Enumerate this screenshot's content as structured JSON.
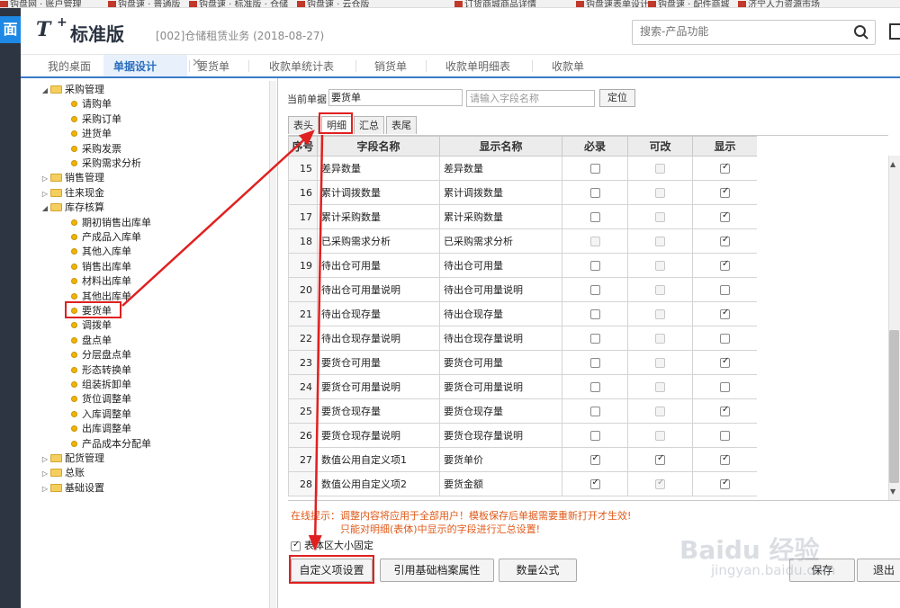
{
  "bookmarks": [
    "钩盘网 · 账户管理",
    "钩盘速 · 普通版",
    "钩盘速 · 标准版 · 仓储",
    "钩盘速 · 云仓版",
    "订货商城商品详情",
    "钩盘速表单设计",
    "钩盘速 · 配件商城",
    "济宁人力资源市场"
  ],
  "rail": {
    "logo": "面"
  },
  "header": {
    "app_name": "标准版",
    "company": "[002]仓储租赁业务   (2018-08-27)",
    "search_placeholder": "搜索-产品功能"
  },
  "tabs": [
    {
      "label": "我的桌面"
    },
    {
      "label": "单据设计"
    },
    {
      "label": "要货单"
    },
    {
      "label": "收款单统计表"
    },
    {
      "label": "销货单"
    },
    {
      "label": "收款单明细表"
    },
    {
      "label": "收款单"
    }
  ],
  "tab_close": "✕",
  "tree": [
    {
      "label": "采购管理",
      "kind": "folder",
      "open": true
    },
    {
      "label": "请购单",
      "kind": "leaf"
    },
    {
      "label": "采购订单",
      "kind": "leaf"
    },
    {
      "label": "进货单",
      "kind": "leaf"
    },
    {
      "label": "采购发票",
      "kind": "leaf"
    },
    {
      "label": "采购需求分析",
      "kind": "leaf"
    },
    {
      "label": "销售管理",
      "kind": "folder",
      "open": false
    },
    {
      "label": "往来现金",
      "kind": "folder",
      "open": false
    },
    {
      "label": "库存核算",
      "kind": "folder",
      "open": true
    },
    {
      "label": "期初销售出库单",
      "kind": "leaf"
    },
    {
      "label": "产成品入库单",
      "kind": "leaf"
    },
    {
      "label": "其他入库单",
      "kind": "leaf"
    },
    {
      "label": "销售出库单",
      "kind": "leaf"
    },
    {
      "label": "材料出库单",
      "kind": "leaf"
    },
    {
      "label": "其他出库单",
      "kind": "leaf"
    },
    {
      "label": "要货单",
      "kind": "leaf"
    },
    {
      "label": "调拨单",
      "kind": "leaf"
    },
    {
      "label": "盘点单",
      "kind": "leaf"
    },
    {
      "label": "分层盘点单",
      "kind": "leaf"
    },
    {
      "label": "形态转换单",
      "kind": "leaf"
    },
    {
      "label": "组装拆卸单",
      "kind": "leaf"
    },
    {
      "label": "货位调整单",
      "kind": "leaf"
    },
    {
      "label": "入库调整单",
      "kind": "leaf"
    },
    {
      "label": "出库调整单",
      "kind": "leaf"
    },
    {
      "label": "产品成本分配单",
      "kind": "leaf"
    },
    {
      "label": "配货管理",
      "kind": "folder",
      "open": false
    },
    {
      "label": "总账",
      "kind": "folder",
      "open": false
    },
    {
      "label": "基础设置",
      "kind": "folder",
      "open": false
    }
  ],
  "form": {
    "current_label": "当前单据",
    "current_value": "要货单",
    "field_placeholder": "请输入字段名称",
    "locate_label": "定位"
  },
  "subtabs": [
    "表头",
    "明细",
    "汇总",
    "表尾"
  ],
  "grid": {
    "columns": [
      "序号",
      "字段名称",
      "显示名称",
      "必录",
      "可改",
      "显示"
    ],
    "rows": [
      {
        "no": "15",
        "field": "差异数量",
        "display": "差异数量",
        "required": false,
        "required_dis": false,
        "editable": false,
        "editable_dis": true,
        "show": true
      },
      {
        "no": "16",
        "field": "累计调拨数量",
        "display": "累计调拨数量",
        "required": false,
        "required_dis": false,
        "editable": false,
        "editable_dis": true,
        "show": true
      },
      {
        "no": "17",
        "field": "累计采购数量",
        "display": "累计采购数量",
        "required": false,
        "required_dis": false,
        "editable": false,
        "editable_dis": true,
        "show": true
      },
      {
        "no": "18",
        "field": "已采购需求分析",
        "display": "已采购需求分析",
        "required": false,
        "required_dis": true,
        "editable": false,
        "editable_dis": true,
        "show": true
      },
      {
        "no": "19",
        "field": "待出仓可用量",
        "display": "待出仓可用量",
        "required": false,
        "required_dis": false,
        "editable": false,
        "editable_dis": true,
        "show": true
      },
      {
        "no": "20",
        "field": "待出仓可用量说明",
        "display": "待出仓可用量说明",
        "required": false,
        "required_dis": false,
        "editable": false,
        "editable_dis": true,
        "show": false
      },
      {
        "no": "21",
        "field": "待出仓现存量",
        "display": "待出仓现存量",
        "required": false,
        "required_dis": false,
        "editable": false,
        "editable_dis": true,
        "show": true
      },
      {
        "no": "22",
        "field": "待出仓现存量说明",
        "display": "待出仓现存量说明",
        "required": false,
        "required_dis": false,
        "editable": false,
        "editable_dis": true,
        "show": false
      },
      {
        "no": "23",
        "field": "要货仓可用量",
        "display": "要货仓可用量",
        "required": false,
        "required_dis": false,
        "editable": false,
        "editable_dis": true,
        "show": true
      },
      {
        "no": "24",
        "field": "要货仓可用量说明",
        "display": "要货仓可用量说明",
        "required": false,
        "required_dis": false,
        "editable": false,
        "editable_dis": true,
        "show": false
      },
      {
        "no": "25",
        "field": "要货仓现存量",
        "display": "要货仓现存量",
        "required": false,
        "required_dis": false,
        "editable": false,
        "editable_dis": true,
        "show": true
      },
      {
        "no": "26",
        "field": "要货仓现存量说明",
        "display": "要货仓现存量说明",
        "required": false,
        "required_dis": false,
        "editable": false,
        "editable_dis": true,
        "show": false
      },
      {
        "no": "27",
        "field": "数值公用自定义项1",
        "display": "要货单价",
        "required": true,
        "required_dis": false,
        "editable": true,
        "editable_dis": false,
        "show": true
      },
      {
        "no": "28",
        "field": "数值公用自定义项2",
        "display": "要货金额",
        "required": true,
        "required_dis": false,
        "editable": true,
        "editable_dis": true,
        "show": true
      }
    ]
  },
  "notice": {
    "line1": "在线提示：调整内容将应用于全部用户！模板保存后单据需要重新打开才生效!",
    "line2": "只能对明细(表体)中显示的字段进行汇总设置!"
  },
  "fixed_area_label": "表体区大小固定",
  "fixed_area_checked": true,
  "buttons": {
    "custom": "自定义项设置",
    "ref_archive": "引用基础档案属性",
    "qty_formula": "数量公式",
    "save": "保存",
    "exit": "退出"
  },
  "watermark": {
    "brand": "Baidu 经验",
    "url": "jingyan.baidu.com"
  },
  "colors": {
    "accent": "#2a6ebf",
    "highlight": "#e02020",
    "notice": "#e05a1a",
    "rail": "#2c3541"
  }
}
